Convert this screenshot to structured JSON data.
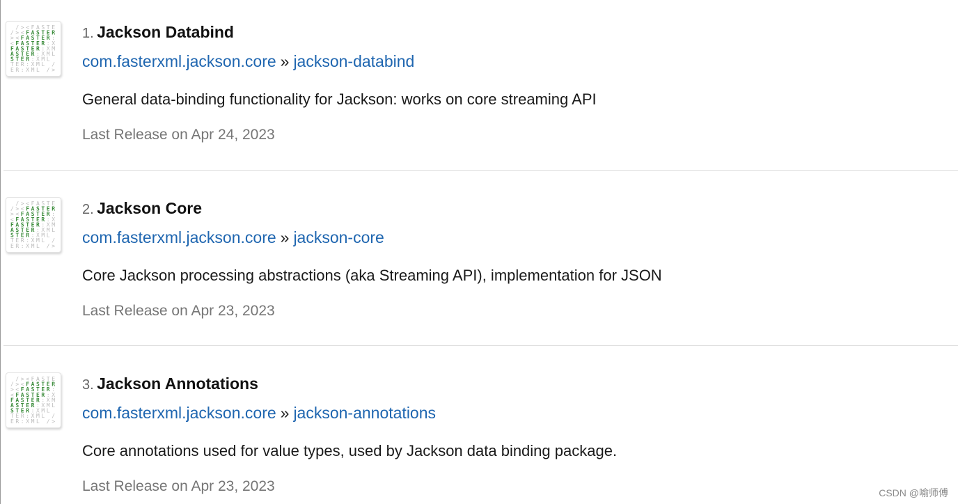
{
  "results": [
    {
      "rank": "1.",
      "name": "Jackson Databind",
      "group": "com.fasterxml.jackson.core",
      "separator": "»",
      "artifact": "jackson-databind",
      "description": "General data-binding functionality for Jackson: works on core streaming API",
      "release": "Last Release on Apr 24, 2023",
      "icon": "fasterxml-logo-icon"
    },
    {
      "rank": "2.",
      "name": "Jackson Core",
      "group": "com.fasterxml.jackson.core",
      "separator": "»",
      "artifact": "jackson-core",
      "description": "Core Jackson processing abstractions (aka Streaming API), implementation for JSON",
      "release": "Last Release on Apr 23, 2023",
      "icon": "fasterxml-logo-icon"
    },
    {
      "rank": "3.",
      "name": "Jackson Annotations",
      "group": "com.fasterxml.jackson.core",
      "separator": "»",
      "artifact": "jackson-annotations",
      "description": "Core annotations used for value types, used by Jackson data binding package.",
      "release": "Last Release on Apr 23, 2023",
      "icon": "fasterxml-logo-icon"
    }
  ],
  "watermark": "CSDN @喻师傅",
  "logo_rows": [
    " /><FASTE",
    "/><FASTER",
    "><FASTER:",
    "<FASTER:X",
    "FASTER:XM",
    "ASTER:XML",
    "STER:XML ",
    "TER:XML /",
    "ER:XML />"
  ],
  "colors": {
    "link": "#1f66b0",
    "logo_green": "#3c8c3c",
    "logo_grey": "#bdbdbd"
  }
}
